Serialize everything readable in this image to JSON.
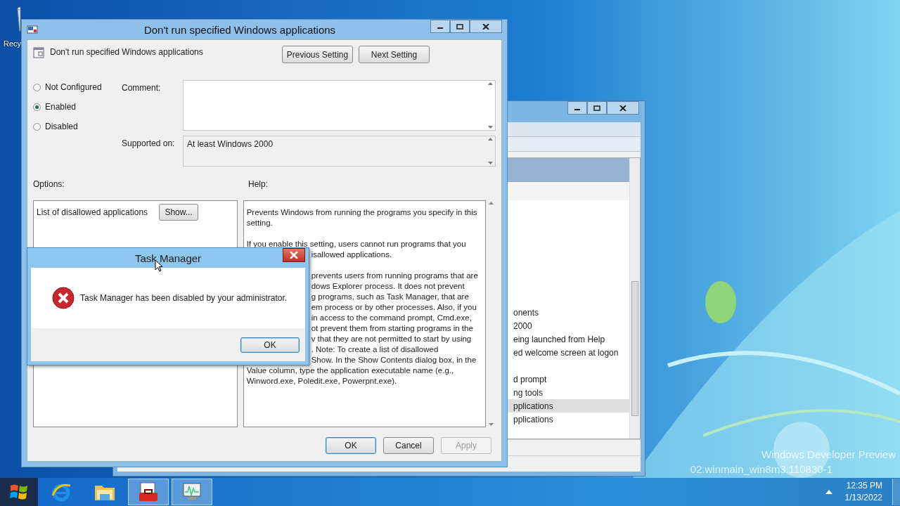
{
  "desktop": {
    "icons": [
      {
        "label": "Recy"
      }
    ],
    "watermark": [
      "Windows Developer Preview",
      "02.winmain_win8m3.110830-1"
    ]
  },
  "background_window": {
    "rows": [
      {
        "text": "onents",
        "selected": false
      },
      {
        "text": "2000",
        "selected": false
      },
      {
        "text": "eing launched from Help",
        "selected": false
      },
      {
        "text": "ed welcome screen at logon",
        "selected": false
      },
      {
        "text": "",
        "selected": false
      },
      {
        "text": "d prompt",
        "selected": false
      },
      {
        "text": "ng tools",
        "selected": false
      },
      {
        "text": "pplications",
        "selected": true
      },
      {
        "text": "pplications",
        "selected": false
      }
    ]
  },
  "policy_window": {
    "title": "Don't run specified Windows applications",
    "header_label": "Don't run specified Windows applications",
    "nav_buttons": [
      "Previous Setting",
      "Next Setting"
    ],
    "radios": [
      {
        "label": "Not Configured",
        "selected": false
      },
      {
        "label": "Enabled",
        "selected": true
      },
      {
        "label": "Disabled",
        "selected": false
      }
    ],
    "comment_label": "Comment:",
    "supported_label": "Supported on:",
    "supported_value": "At least Windows 2000",
    "options_label": "Options:",
    "help_label": "Help:",
    "option_row": {
      "label": "List of disallowed applications",
      "button": "Show..."
    },
    "help": [
      {
        "lines": [
          {
            "text": "Prevents Windows from running the programs you specify in this",
            "cut": false
          },
          {
            "text": "setting.",
            "cut": false
          }
        ]
      },
      {
        "lines": [
          {
            "text": "If you enable this setting, users cannot run programs that you",
            "cut": false
          },
          {
            "text": "isallowed applications.",
            "cut": true
          }
        ]
      },
      {
        "lines": [
          {
            "text": "prevents users from running programs that are",
            "cut": true
          },
          {
            "text": "dows Explorer process. It does not prevent",
            "cut": true
          },
          {
            "text": "g programs, such as Task Manager, that are",
            "cut": true
          },
          {
            "text": "em process or by other processes. Also, if you",
            "cut": true
          },
          {
            "text": "in access to the command prompt, Cmd.exe,",
            "cut": true
          },
          {
            "text": "ot prevent them from starting programs in the",
            "cut": true
          },
          {
            "text": "v that they are not permitted to start by using",
            "cut": true
          },
          {
            "text": ". Note: To create a list of disallowed",
            "cut": true
          },
          {
            "text": "Show. In the Show Contents dialog box, in the",
            "cut": true
          },
          {
            "text": "Value column, type the application executable name (e.g.,",
            "cut": false
          },
          {
            "text": "Winword.exe, Poledit.exe, Powerpnt.exe).",
            "cut": false
          }
        ]
      }
    ],
    "footer_buttons": [
      {
        "label": "OK",
        "disabled": false,
        "default": true
      },
      {
        "label": "Cancel",
        "disabled": false,
        "default": false
      },
      {
        "label": "Apply",
        "disabled": true,
        "default": false
      }
    ]
  },
  "dialog": {
    "title": "Task Manager",
    "message": "Task Manager has been disabled by your administrator.",
    "button": "OK"
  },
  "taskbar": {
    "apps": [
      {
        "kind": "browser",
        "active": false
      },
      {
        "kind": "folder",
        "active": false
      },
      {
        "kind": "toolbox",
        "active": true
      },
      {
        "kind": "monitor",
        "active": true
      }
    ],
    "clock": {
      "time": "12:35 PM",
      "date": "1/13/2022"
    }
  }
}
